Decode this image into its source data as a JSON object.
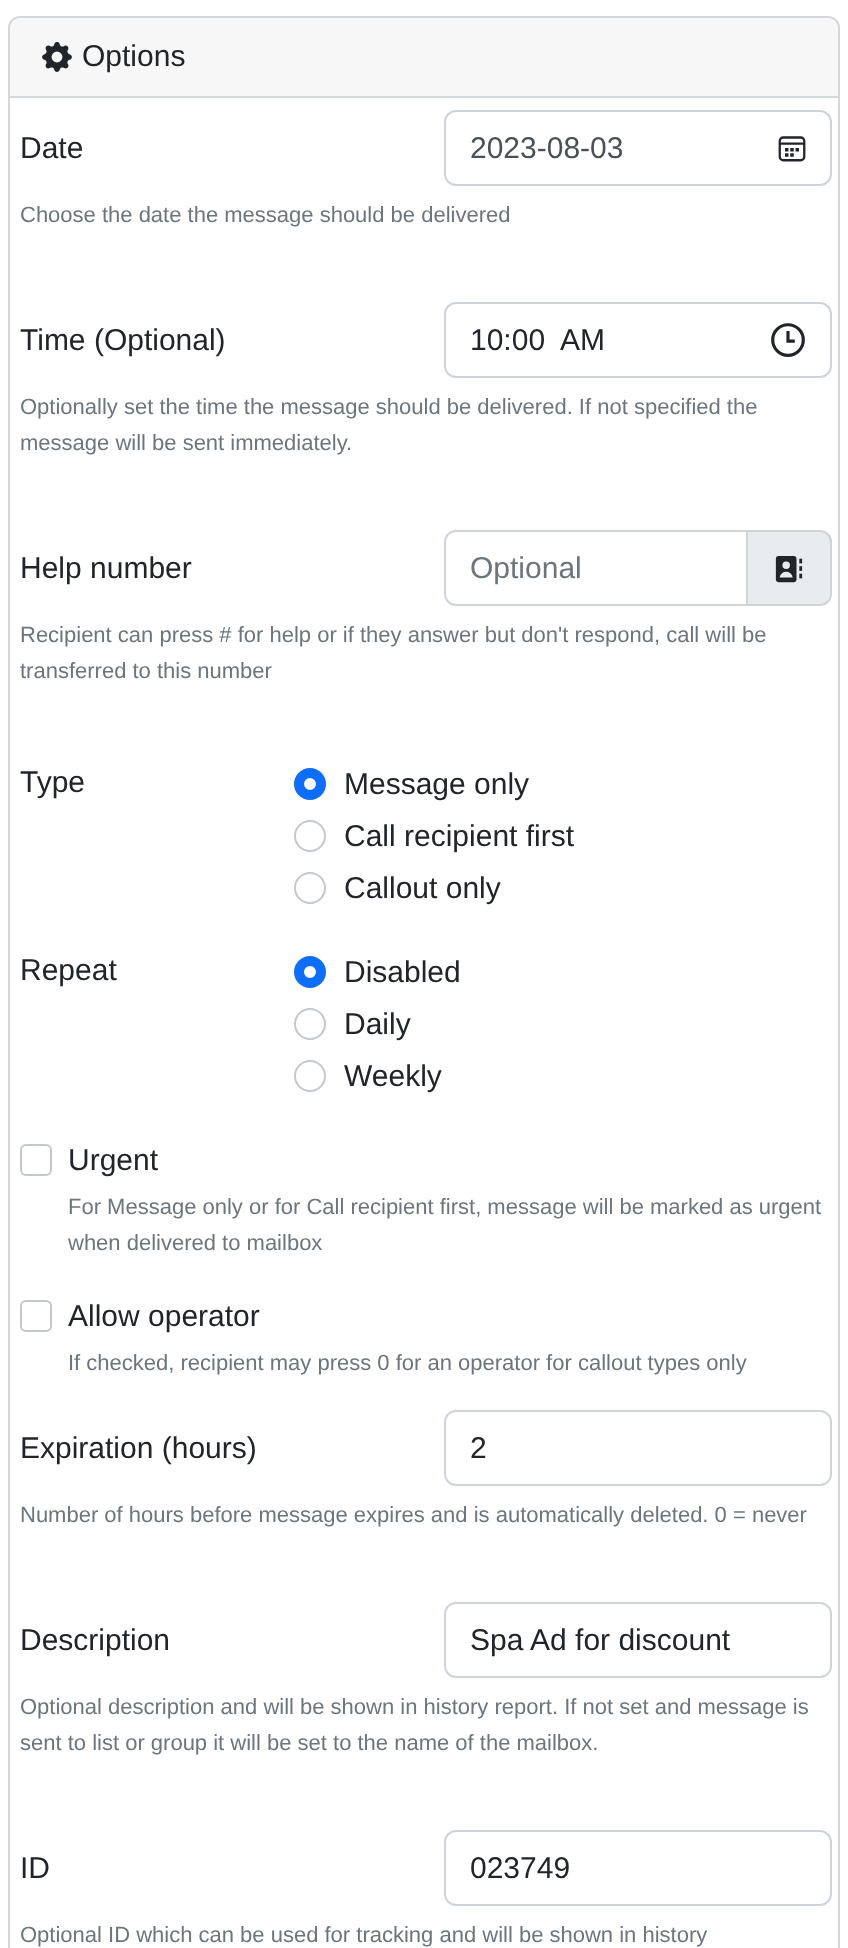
{
  "card": {
    "title": "Options"
  },
  "fields": [
    {
      "kind": "date",
      "label": "Date",
      "value": "2023-08-03",
      "help": "Choose the date the message should be delivered"
    },
    {
      "kind": "time",
      "label": "Time (Optional)",
      "value": "10:00  AM",
      "help": "Optionally set the time the message should be delivered. If not specified the message will be sent immediately."
    },
    {
      "kind": "phone",
      "label": "Help number",
      "placeholder": "Optional",
      "help": "Recipient can press # for help or if they answer but don't respond, call will be transferred to this number"
    },
    {
      "kind": "radio",
      "label": "Type",
      "options": [
        {
          "label": "Message only",
          "selected": true
        },
        {
          "label": "Call recipient first",
          "selected": false
        },
        {
          "label": "Callout only",
          "selected": false
        }
      ]
    },
    {
      "kind": "radio",
      "label": "Repeat",
      "options": [
        {
          "label": "Disabled",
          "selected": true
        },
        {
          "label": "Daily",
          "selected": false
        },
        {
          "label": "Weekly",
          "selected": false
        }
      ]
    },
    {
      "kind": "checkbox",
      "label": "Urgent",
      "checked": false,
      "help": "For Message only or for Call recipient first, message will be marked as urgent when delivered to mailbox"
    },
    {
      "kind": "checkbox",
      "label": "Allow operator",
      "checked": false,
      "help": "If checked, recipient may press 0 for an operator for callout types only"
    },
    {
      "kind": "text",
      "label": "Expiration (hours)",
      "value": "2",
      "help": "Number of hours before message expires and is automatically deleted. 0 = never"
    },
    {
      "kind": "text",
      "label": "Description",
      "value": "Spa Ad for discount",
      "help": "Optional description and will be shown in history report. If not set and message is sent to list or group it will be set to the name of the mailbox."
    },
    {
      "kind": "text",
      "label": "ID",
      "value": "023749",
      "help": "Optional ID which can be used for tracking and will be shown in history"
    }
  ]
}
